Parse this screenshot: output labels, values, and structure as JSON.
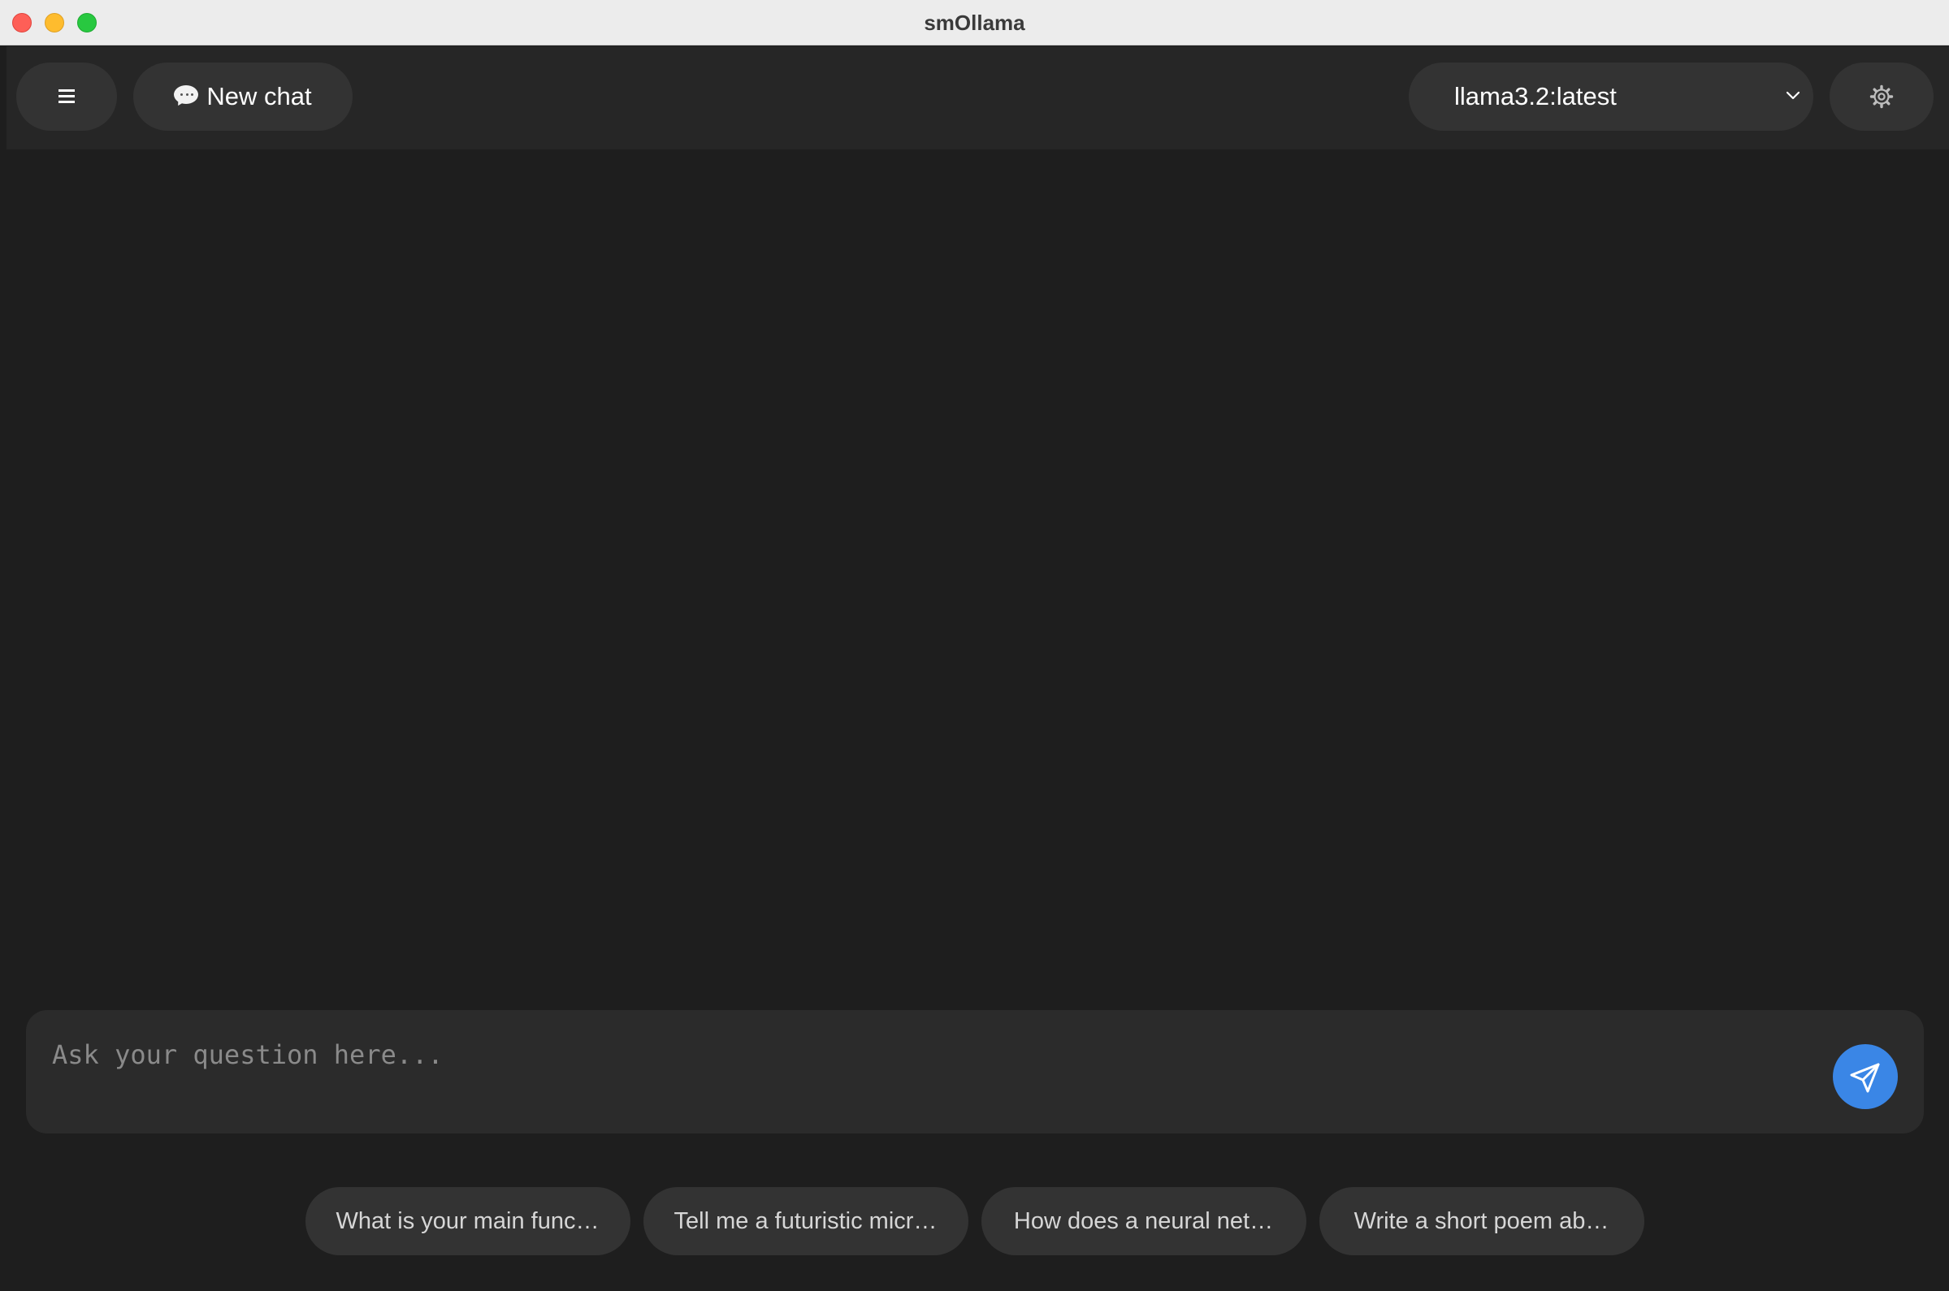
{
  "window": {
    "title": "smOllama"
  },
  "header": {
    "menu_icon": "hamburger-icon",
    "new_chat_label": "New chat",
    "new_chat_icon": "speech-bubble-icon",
    "model_selected": "llama3.2:latest",
    "settings_icon": "gear-icon"
  },
  "input": {
    "placeholder": "Ask your question here...",
    "value": "",
    "send_icon": "paper-plane-icon",
    "send_color": "#3a86e6"
  },
  "suggestions": [
    {
      "label": "What is your main func…"
    },
    {
      "label": "Tell me a futuristic micr…"
    },
    {
      "label": "How does a neural net…"
    },
    {
      "label": "Write a short poem ab…"
    }
  ],
  "colors": {
    "background": "#1e1e1e",
    "header": "#262626",
    "button": "#333333",
    "accent": "#3a86e6"
  }
}
